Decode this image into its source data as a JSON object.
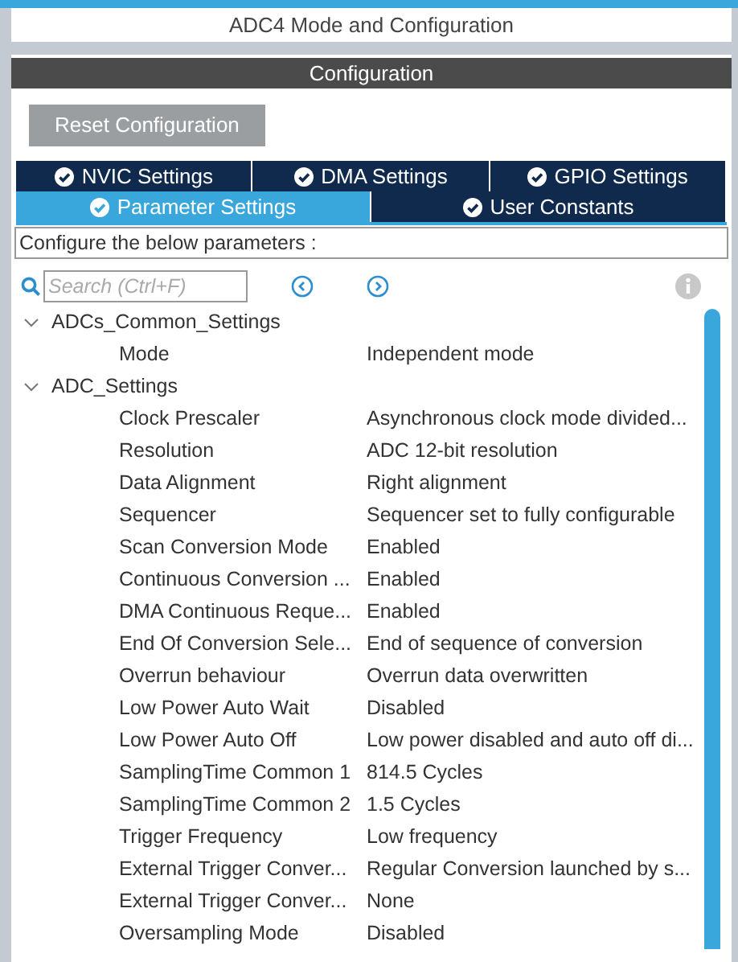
{
  "header": {
    "title": "ADC4 Mode and Configuration"
  },
  "section": {
    "title": "Configuration"
  },
  "reset_button": {
    "label": "Reset Configuration"
  },
  "tab_rows": [
    [
      {
        "label": "NVIC Settings",
        "selected": false
      },
      {
        "label": "DMA Settings",
        "selected": false
      },
      {
        "label": "GPIO Settings",
        "selected": false
      }
    ],
    [
      {
        "label": "Parameter Settings",
        "selected": true
      },
      {
        "label": "User Constants",
        "selected": false
      }
    ]
  ],
  "hint": "Configure the below parameters :",
  "search": {
    "placeholder": "Search (Ctrl+F)"
  },
  "tree": [
    {
      "label": "ADCs_Common_Settings",
      "expanded": true,
      "children": [
        {
          "name": "Mode",
          "value": "Independent mode"
        }
      ]
    },
    {
      "label": "ADC_Settings",
      "expanded": true,
      "children": [
        {
          "name": "Clock Prescaler",
          "value": "Asynchronous clock mode divided..."
        },
        {
          "name": "Resolution",
          "value": "ADC 12-bit resolution"
        },
        {
          "name": "Data Alignment",
          "value": "Right alignment"
        },
        {
          "name": "Sequencer",
          "value": "Sequencer set to fully configurable"
        },
        {
          "name": "Scan Conversion Mode",
          "value": "Enabled"
        },
        {
          "name": "Continuous Conversion ...",
          "value": "Enabled"
        },
        {
          "name": "DMA Continuous Reque...",
          "value": "Enabled"
        },
        {
          "name": "End Of Conversion Sele...",
          "value": "End of sequence of conversion"
        },
        {
          "name": "Overrun behaviour",
          "value": "Overrun data overwritten"
        },
        {
          "name": "Low Power Auto Wait",
          "value": "Disabled"
        },
        {
          "name": "Low Power Auto Off",
          "value": "Low power disabled and auto off di..."
        },
        {
          "name": "SamplingTime Common 1",
          "value": "814.5 Cycles"
        },
        {
          "name": "SamplingTime Common 2",
          "value": "1.5 Cycles"
        },
        {
          "name": "Trigger Frequency",
          "value": "Low frequency"
        },
        {
          "name": "External Trigger Conver...",
          "value": "Regular Conversion launched by s..."
        },
        {
          "name": "External Trigger Conver...",
          "value": "None"
        },
        {
          "name": "Oversampling Mode",
          "value": "Disabled"
        }
      ]
    }
  ]
}
